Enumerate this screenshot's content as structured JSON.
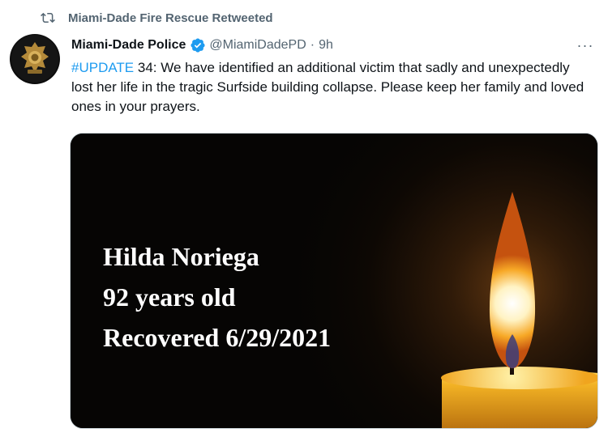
{
  "retweet_context": {
    "text": "Miami-Dade Fire Rescue Retweeted",
    "icon": "retweet-icon"
  },
  "author": {
    "name": "Miami-Dade Police",
    "handle": "@MiamiDadePD",
    "separator": "·",
    "time": "9h",
    "verified_icon": "verified-badge-icon",
    "avatar_icon": "police-badge-avatar"
  },
  "more_label": "···",
  "tweet": {
    "hashtag": "#UPDATE",
    "body": " 34: We have identified an additional victim that sadly and unexpectedly lost her life in the tragic Surfside building collapse. Please keep her family and loved ones in your prayers."
  },
  "media": {
    "lines": [
      "Hilda Noriega",
      "92 years old",
      "Recovered 6/29/2021"
    ],
    "icon": "candle-image"
  },
  "colors": {
    "accent": "#1d9bf0",
    "secondary_text": "#536471",
    "primary_text": "#0f1419"
  }
}
